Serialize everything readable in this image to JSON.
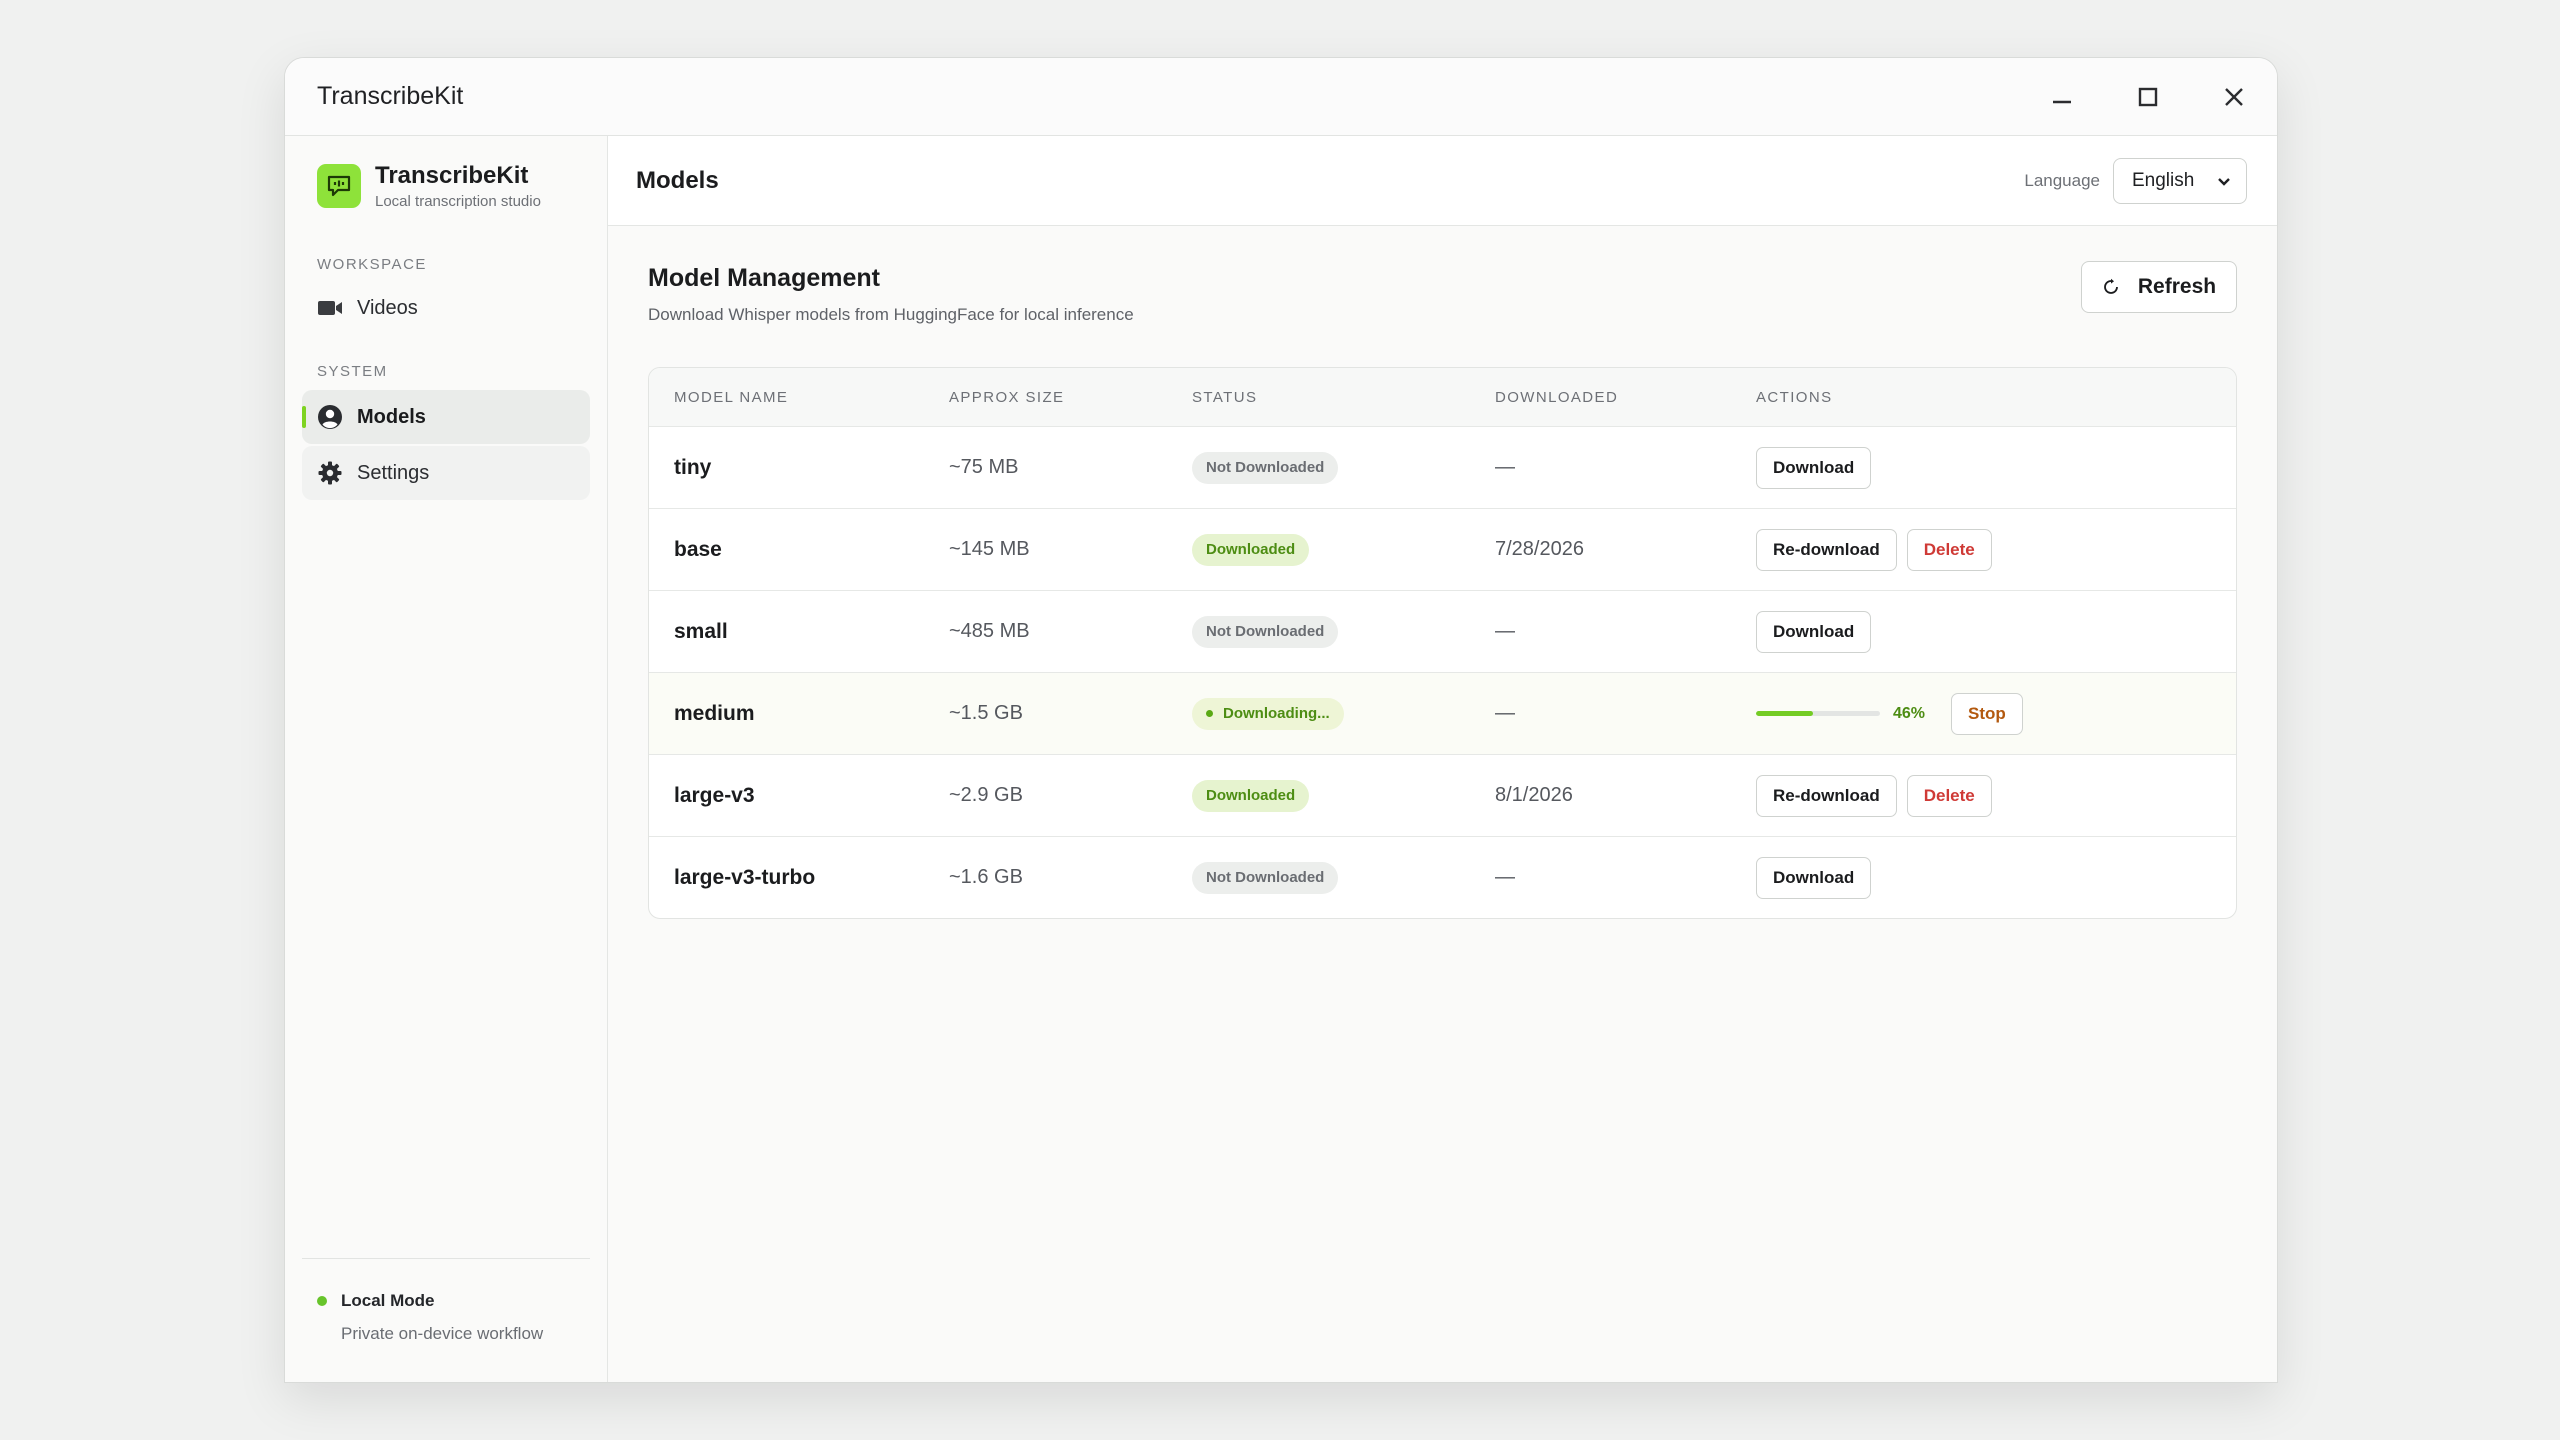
{
  "window": {
    "title": "TranscribeKit"
  },
  "brand": {
    "name": "TranscribeKit",
    "subtitle": "Local transcription studio"
  },
  "sidebar": {
    "sections": [
      {
        "label": "WORKSPACE",
        "items": [
          {
            "label": "Videos",
            "icon": "video-camera-icon"
          }
        ]
      },
      {
        "label": "SYSTEM",
        "items": [
          {
            "label": "Models",
            "icon": "user-circle-icon",
            "active": true
          },
          {
            "label": "Settings",
            "icon": "gear-icon"
          }
        ]
      }
    ],
    "footer": {
      "mode": "Local Mode",
      "description": "Private on-device workflow"
    }
  },
  "topbar": {
    "title": "Models",
    "language_label": "Language",
    "language_value": "English"
  },
  "content": {
    "title": "Model Management",
    "subtitle": "Download Whisper models from HuggingFace for local inference",
    "refresh_label": "Refresh"
  },
  "table": {
    "columns": [
      "MODEL NAME",
      "APPROX SIZE",
      "STATUS",
      "DOWNLOADED",
      "ACTIONS"
    ],
    "rows": [
      {
        "name": "tiny",
        "size": "~75 MB",
        "status": "Not Downloaded",
        "downloaded": "—",
        "actions": [
          "Download"
        ]
      },
      {
        "name": "base",
        "size": "~145 MB",
        "status": "Downloaded",
        "downloaded": "7/28/2026",
        "actions": [
          "Re-download",
          "Delete"
        ]
      },
      {
        "name": "small",
        "size": "~485 MB",
        "status": "Not Downloaded",
        "downloaded": "—",
        "actions": [
          "Download"
        ]
      },
      {
        "name": "medium",
        "size": "~1.5 GB",
        "status": "Downloading...",
        "downloaded": "—",
        "progress_percent": 46,
        "progress_label": "46%",
        "actions": [
          "Stop"
        ]
      },
      {
        "name": "large-v3",
        "size": "~2.9 GB",
        "status": "Downloaded",
        "downloaded": "8/1/2026",
        "actions": [
          "Re-download",
          "Delete"
        ]
      },
      {
        "name": "large-v3-turbo",
        "size": "~1.6 GB",
        "status": "Not Downloaded",
        "downloaded": "—",
        "actions": [
          "Download"
        ]
      }
    ]
  },
  "colors": {
    "accent": "#7ed321",
    "success_text": "#4d8d13",
    "danger": "#cf3a36",
    "stop": "#b3590f"
  }
}
